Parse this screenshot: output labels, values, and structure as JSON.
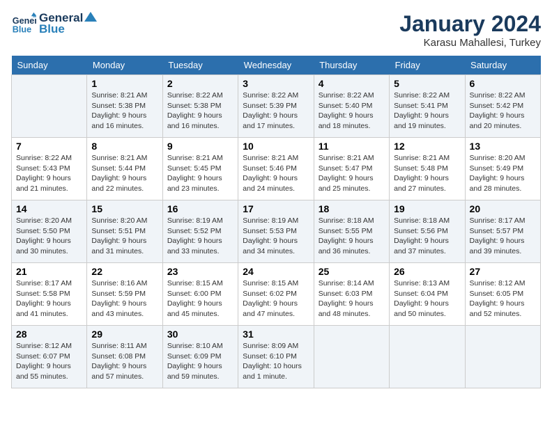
{
  "header": {
    "logo_line1": "General",
    "logo_line2": "Blue",
    "month": "January 2024",
    "location": "Karasu Mahallesi, Turkey"
  },
  "days_of_week": [
    "Sunday",
    "Monday",
    "Tuesday",
    "Wednesday",
    "Thursday",
    "Friday",
    "Saturday"
  ],
  "weeks": [
    [
      {
        "day": "",
        "sunrise": "",
        "sunset": "",
        "daylight": ""
      },
      {
        "day": "1",
        "sunrise": "Sunrise: 8:21 AM",
        "sunset": "Sunset: 5:38 PM",
        "daylight": "Daylight: 9 hours and 16 minutes."
      },
      {
        "day": "2",
        "sunrise": "Sunrise: 8:22 AM",
        "sunset": "Sunset: 5:38 PM",
        "daylight": "Daylight: 9 hours and 16 minutes."
      },
      {
        "day": "3",
        "sunrise": "Sunrise: 8:22 AM",
        "sunset": "Sunset: 5:39 PM",
        "daylight": "Daylight: 9 hours and 17 minutes."
      },
      {
        "day": "4",
        "sunrise": "Sunrise: 8:22 AM",
        "sunset": "Sunset: 5:40 PM",
        "daylight": "Daylight: 9 hours and 18 minutes."
      },
      {
        "day": "5",
        "sunrise": "Sunrise: 8:22 AM",
        "sunset": "Sunset: 5:41 PM",
        "daylight": "Daylight: 9 hours and 19 minutes."
      },
      {
        "day": "6",
        "sunrise": "Sunrise: 8:22 AM",
        "sunset": "Sunset: 5:42 PM",
        "daylight": "Daylight: 9 hours and 20 minutes."
      }
    ],
    [
      {
        "day": "7",
        "sunrise": "Sunrise: 8:22 AM",
        "sunset": "Sunset: 5:43 PM",
        "daylight": "Daylight: 9 hours and 21 minutes."
      },
      {
        "day": "8",
        "sunrise": "Sunrise: 8:21 AM",
        "sunset": "Sunset: 5:44 PM",
        "daylight": "Daylight: 9 hours and 22 minutes."
      },
      {
        "day": "9",
        "sunrise": "Sunrise: 8:21 AM",
        "sunset": "Sunset: 5:45 PM",
        "daylight": "Daylight: 9 hours and 23 minutes."
      },
      {
        "day": "10",
        "sunrise": "Sunrise: 8:21 AM",
        "sunset": "Sunset: 5:46 PM",
        "daylight": "Daylight: 9 hours and 24 minutes."
      },
      {
        "day": "11",
        "sunrise": "Sunrise: 8:21 AM",
        "sunset": "Sunset: 5:47 PM",
        "daylight": "Daylight: 9 hours and 25 minutes."
      },
      {
        "day": "12",
        "sunrise": "Sunrise: 8:21 AM",
        "sunset": "Sunset: 5:48 PM",
        "daylight": "Daylight: 9 hours and 27 minutes."
      },
      {
        "day": "13",
        "sunrise": "Sunrise: 8:20 AM",
        "sunset": "Sunset: 5:49 PM",
        "daylight": "Daylight: 9 hours and 28 minutes."
      }
    ],
    [
      {
        "day": "14",
        "sunrise": "Sunrise: 8:20 AM",
        "sunset": "Sunset: 5:50 PM",
        "daylight": "Daylight: 9 hours and 30 minutes."
      },
      {
        "day": "15",
        "sunrise": "Sunrise: 8:20 AM",
        "sunset": "Sunset: 5:51 PM",
        "daylight": "Daylight: 9 hours and 31 minutes."
      },
      {
        "day": "16",
        "sunrise": "Sunrise: 8:19 AM",
        "sunset": "Sunset: 5:52 PM",
        "daylight": "Daylight: 9 hours and 33 minutes."
      },
      {
        "day": "17",
        "sunrise": "Sunrise: 8:19 AM",
        "sunset": "Sunset: 5:53 PM",
        "daylight": "Daylight: 9 hours and 34 minutes."
      },
      {
        "day": "18",
        "sunrise": "Sunrise: 8:18 AM",
        "sunset": "Sunset: 5:55 PM",
        "daylight": "Daylight: 9 hours and 36 minutes."
      },
      {
        "day": "19",
        "sunrise": "Sunrise: 8:18 AM",
        "sunset": "Sunset: 5:56 PM",
        "daylight": "Daylight: 9 hours and 37 minutes."
      },
      {
        "day": "20",
        "sunrise": "Sunrise: 8:17 AM",
        "sunset": "Sunset: 5:57 PM",
        "daylight": "Daylight: 9 hours and 39 minutes."
      }
    ],
    [
      {
        "day": "21",
        "sunrise": "Sunrise: 8:17 AM",
        "sunset": "Sunset: 5:58 PM",
        "daylight": "Daylight: 9 hours and 41 minutes."
      },
      {
        "day": "22",
        "sunrise": "Sunrise: 8:16 AM",
        "sunset": "Sunset: 5:59 PM",
        "daylight": "Daylight: 9 hours and 43 minutes."
      },
      {
        "day": "23",
        "sunrise": "Sunrise: 8:15 AM",
        "sunset": "Sunset: 6:00 PM",
        "daylight": "Daylight: 9 hours and 45 minutes."
      },
      {
        "day": "24",
        "sunrise": "Sunrise: 8:15 AM",
        "sunset": "Sunset: 6:02 PM",
        "daylight": "Daylight: 9 hours and 47 minutes."
      },
      {
        "day": "25",
        "sunrise": "Sunrise: 8:14 AM",
        "sunset": "Sunset: 6:03 PM",
        "daylight": "Daylight: 9 hours and 48 minutes."
      },
      {
        "day": "26",
        "sunrise": "Sunrise: 8:13 AM",
        "sunset": "Sunset: 6:04 PM",
        "daylight": "Daylight: 9 hours and 50 minutes."
      },
      {
        "day": "27",
        "sunrise": "Sunrise: 8:12 AM",
        "sunset": "Sunset: 6:05 PM",
        "daylight": "Daylight: 9 hours and 52 minutes."
      }
    ],
    [
      {
        "day": "28",
        "sunrise": "Sunrise: 8:12 AM",
        "sunset": "Sunset: 6:07 PM",
        "daylight": "Daylight: 9 hours and 55 minutes."
      },
      {
        "day": "29",
        "sunrise": "Sunrise: 8:11 AM",
        "sunset": "Sunset: 6:08 PM",
        "daylight": "Daylight: 9 hours and 57 minutes."
      },
      {
        "day": "30",
        "sunrise": "Sunrise: 8:10 AM",
        "sunset": "Sunset: 6:09 PM",
        "daylight": "Daylight: 9 hours and 59 minutes."
      },
      {
        "day": "31",
        "sunrise": "Sunrise: 8:09 AM",
        "sunset": "Sunset: 6:10 PM",
        "daylight": "Daylight: 10 hours and 1 minute."
      },
      {
        "day": "",
        "sunrise": "",
        "sunset": "",
        "daylight": ""
      },
      {
        "day": "",
        "sunrise": "",
        "sunset": "",
        "daylight": ""
      },
      {
        "day": "",
        "sunrise": "",
        "sunset": "",
        "daylight": ""
      }
    ]
  ]
}
